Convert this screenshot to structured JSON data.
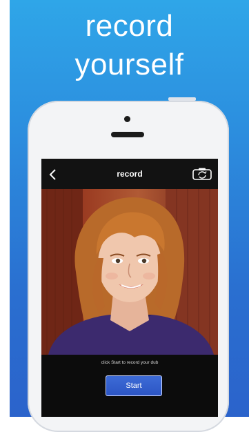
{
  "headline": {
    "line1": "record",
    "line2": "yourself"
  },
  "screen": {
    "title": "record",
    "back_icon": "chevron-left-icon",
    "camera_icon": "camera-switch-icon",
    "hint": "click Start to record your dub",
    "start_label": "Start"
  },
  "colors": {
    "poster_top": "#2fa6e8",
    "poster_bottom": "#2b63cb",
    "button": "#2c55c4"
  }
}
